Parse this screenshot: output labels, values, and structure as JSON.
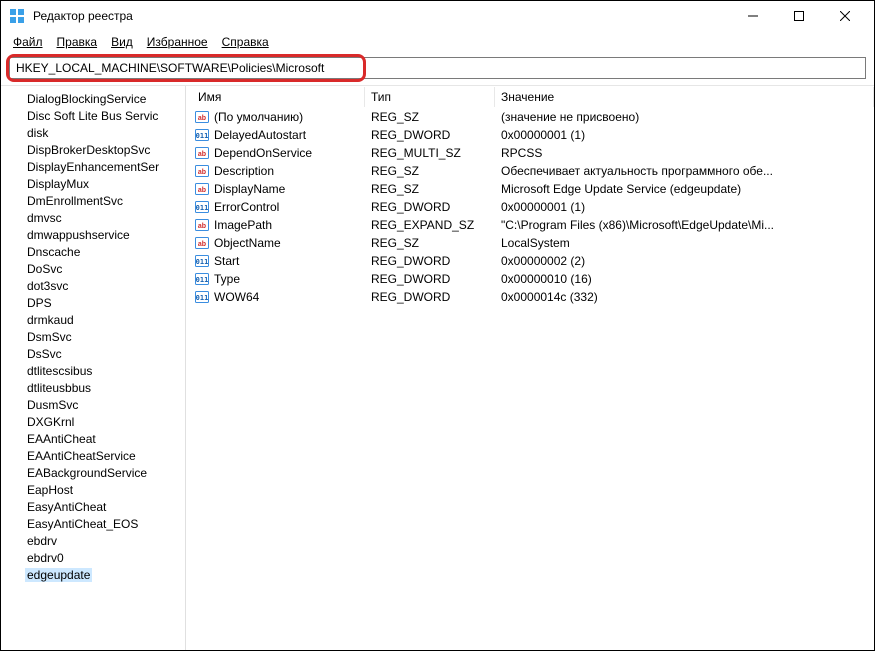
{
  "window": {
    "title": "Редактор реестра"
  },
  "menu": {
    "file": "Файл",
    "edit": "Правка",
    "view": "Вид",
    "favorites": "Избранное",
    "help": "Справка"
  },
  "address": {
    "path": "HKEY_LOCAL_MACHINE\\SOFTWARE\\Policies\\Microsoft"
  },
  "columns": {
    "name": "Имя",
    "type": "Тип",
    "data": "Значение"
  },
  "tree": {
    "items": [
      "DialogBlockingService",
      "Disc Soft Lite Bus Servic",
      "disk",
      "DispBrokerDesktopSvc",
      "DisplayEnhancementSer",
      "DisplayMux",
      "DmEnrollmentSvc",
      "dmvsc",
      "dmwappushservice",
      "Dnscache",
      "DoSvc",
      "dot3svc",
      "DPS",
      "drmkaud",
      "DsmSvc",
      "DsSvc",
      "dtlitescsibus",
      "dtliteusbbus",
      "DusmSvc",
      "DXGKrnl",
      "EAAntiCheat",
      "EAAntiCheatService",
      "EABackgroundService",
      "EapHost",
      "EasyAntiCheat",
      "EasyAntiCheat_EOS",
      "ebdrv",
      "ebdrv0",
      "edgeupdate",
      ""
    ],
    "selected": "edgeupdate"
  },
  "values": [
    {
      "icon": "sz",
      "name": "(По умолчанию)",
      "type": "REG_SZ",
      "data": "(значение не присвоено)"
    },
    {
      "icon": "bin",
      "name": "DelayedAutostart",
      "type": "REG_DWORD",
      "data": "0x00000001 (1)"
    },
    {
      "icon": "sz",
      "name": "DependOnService",
      "type": "REG_MULTI_SZ",
      "data": "RPCSS"
    },
    {
      "icon": "sz",
      "name": "Description",
      "type": "REG_SZ",
      "data": "Обеспечивает актуальность программного обе..."
    },
    {
      "icon": "sz",
      "name": "DisplayName",
      "type": "REG_SZ",
      "data": "Microsoft Edge Update Service (edgeupdate)"
    },
    {
      "icon": "bin",
      "name": "ErrorControl",
      "type": "REG_DWORD",
      "data": "0x00000001 (1)"
    },
    {
      "icon": "sz",
      "name": "ImagePath",
      "type": "REG_EXPAND_SZ",
      "data": "\"C:\\Program Files (x86)\\Microsoft\\EdgeUpdate\\Mi..."
    },
    {
      "icon": "sz",
      "name": "ObjectName",
      "type": "REG_SZ",
      "data": "LocalSystem"
    },
    {
      "icon": "bin",
      "name": "Start",
      "type": "REG_DWORD",
      "data": "0x00000002 (2)"
    },
    {
      "icon": "bin",
      "name": "Type",
      "type": "REG_DWORD",
      "data": "0x00000010 (16)"
    },
    {
      "icon": "bin",
      "name": "WOW64",
      "type": "REG_DWORD",
      "data": "0x0000014c (332)"
    }
  ]
}
